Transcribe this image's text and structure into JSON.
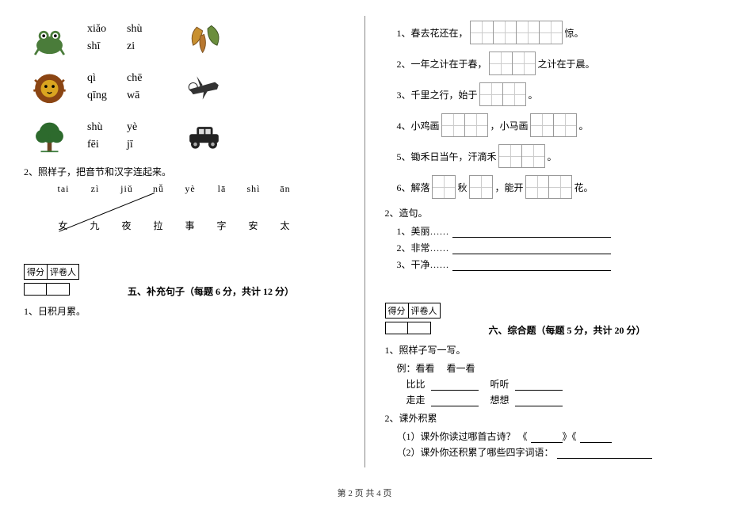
{
  "left": {
    "pinyin_rows": [
      {
        "py": [
          [
            "xiǎo",
            "shù"
          ],
          [
            "shī",
            "zi"
          ]
        ]
      },
      {
        "py": [
          [
            "qì",
            "chē"
          ],
          [
            "qīng",
            "wā"
          ]
        ]
      },
      {
        "py": [
          [
            "shù",
            "yè"
          ],
          [
            "fēi",
            "jī"
          ]
        ]
      }
    ],
    "q2_title": "2、照样子，把音节和汉字连起来。",
    "syllables": [
      "tai",
      "zì",
      "jiǔ",
      "nǚ",
      "yè",
      "lā",
      "shì",
      "ān"
    ],
    "hanzi": [
      "女",
      "九",
      "夜",
      "拉",
      "事",
      "字",
      "安",
      "太"
    ],
    "score_labels": {
      "a": "得分",
      "b": "评卷人"
    },
    "section5": "五、补充句子（每题 6 分，共计 12 分）",
    "q5_1": "1、日积月累。"
  },
  "right": {
    "fills": [
      {
        "pre": "1、春去花还在，",
        "boxes": 4,
        "post": "惊。"
      },
      {
        "pre": "2、一年之计在于春，",
        "boxes": 2,
        "post": "之计在于晨。"
      },
      {
        "pre": "3、千里之行，始于",
        "boxes": 2,
        "post": "。"
      },
      {
        "pre": "4、小鸡画",
        "boxes": 2,
        "mid": "，小马画",
        "boxes2": 2,
        "post": "。"
      },
      {
        "pre": "5、锄禾日当午，汗滴禾",
        "boxes": 2,
        "post": "。"
      },
      {
        "pre": "6、解落",
        "boxes": 1,
        "mid": "秋",
        "boxes2": 1,
        "mid2": "，能开",
        "boxes3": 2,
        "post": "花。"
      }
    ],
    "q2_title": "2、造句。",
    "make_sentences": [
      "1、美丽……",
      "2、非常……",
      "3、干净……"
    ],
    "score_labels": {
      "a": "得分",
      "b": "评卷人"
    },
    "section6": "六、综合题（每题 5 分，共计 20 分）",
    "q6_1": "1、照样子写一写。",
    "example_label": "例：看看",
    "example_answer": "看一看",
    "practice_words": [
      [
        "比比",
        "听听"
      ],
      [
        "走走",
        "想想"
      ]
    ],
    "q6_2": "2、课外积累",
    "q6_2_1": "（1）课外你读过哪首古诗？ 《",
    "q6_2_1_mid": "》《",
    "q6_2_2": "（2）课外你还积累了哪些四字词语："
  },
  "footer": "第 2 页 共 4 页"
}
